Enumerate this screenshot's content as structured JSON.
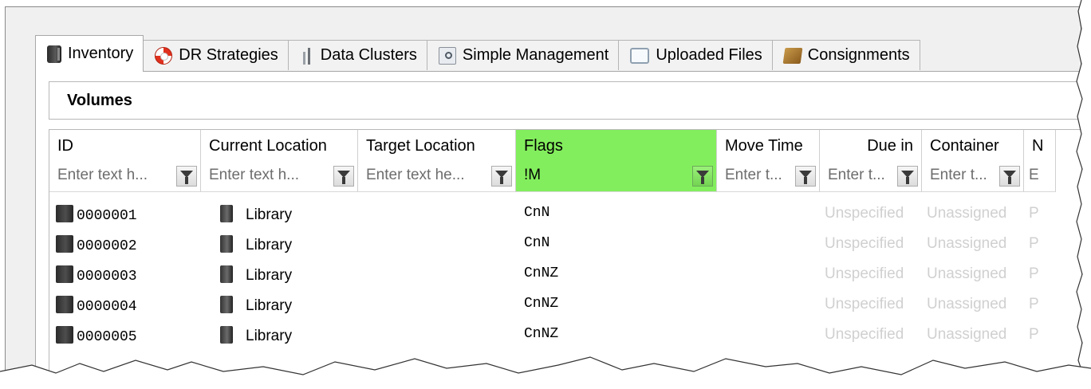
{
  "tabs": [
    {
      "label": "Inventory",
      "icon": "inventory-icon",
      "active": true
    },
    {
      "label": "DR Strategies",
      "icon": "lifebuoy-icon",
      "active": false
    },
    {
      "label": "Data Clusters",
      "icon": "data-clusters-icon",
      "active": false
    },
    {
      "label": "Simple Management",
      "icon": "simple-management-icon",
      "active": false
    },
    {
      "label": "Uploaded Files",
      "icon": "uploaded-files-icon",
      "active": false
    },
    {
      "label": "Consignments",
      "icon": "consignment-box-icon",
      "active": false
    }
  ],
  "panel": {
    "title": "Volumes"
  },
  "grid": {
    "columns": [
      {
        "key": "id",
        "header": "ID",
        "filter_placeholder": "Enter text h...",
        "filter_value": ""
      },
      {
        "key": "current_location",
        "header": "Current Location",
        "filter_placeholder": "Enter text h...",
        "filter_value": ""
      },
      {
        "key": "target_location",
        "header": "Target Location",
        "filter_placeholder": "Enter text he...",
        "filter_value": ""
      },
      {
        "key": "flags",
        "header": "Flags",
        "filter_placeholder": "",
        "filter_value": "!M"
      },
      {
        "key": "move_time",
        "header": "Move Time",
        "filter_placeholder": "Enter t...",
        "filter_value": ""
      },
      {
        "key": "due_in",
        "header": "Due in",
        "filter_placeholder": "Enter t...",
        "filter_value": ""
      },
      {
        "key": "container",
        "header": "Container",
        "filter_placeholder": "Enter t...",
        "filter_value": ""
      },
      {
        "key": "next",
        "header": "N",
        "filter_placeholder": "E",
        "filter_value": ""
      }
    ],
    "rows": [
      {
        "id": "0000001",
        "current_location": "Library",
        "target_location": "",
        "flags": "CnN",
        "move_time": "",
        "due_in": "Unspecified",
        "container": "Unassigned",
        "next": "P"
      },
      {
        "id": "0000002",
        "current_location": "Library",
        "target_location": "",
        "flags": "CnN",
        "move_time": "",
        "due_in": "Unspecified",
        "container": "Unassigned",
        "next": "P"
      },
      {
        "id": "0000003",
        "current_location": "Library",
        "target_location": "",
        "flags": "CnNZ",
        "move_time": "",
        "due_in": "Unspecified",
        "container": "Unassigned",
        "next": "P"
      },
      {
        "id": "0000004",
        "current_location": "Library",
        "target_location": "",
        "flags": "CnNZ",
        "move_time": "",
        "due_in": "Unspecified",
        "container": "Unassigned",
        "next": "P"
      },
      {
        "id": "0000005",
        "current_location": "Library",
        "target_location": "",
        "flags": "CnNZ",
        "move_time": "",
        "due_in": "Unspecified",
        "container": "Unassigned",
        "next": "P"
      }
    ]
  },
  "colors": {
    "filter_active": "#83ee5d",
    "muted_text": "#d0d0d0"
  }
}
